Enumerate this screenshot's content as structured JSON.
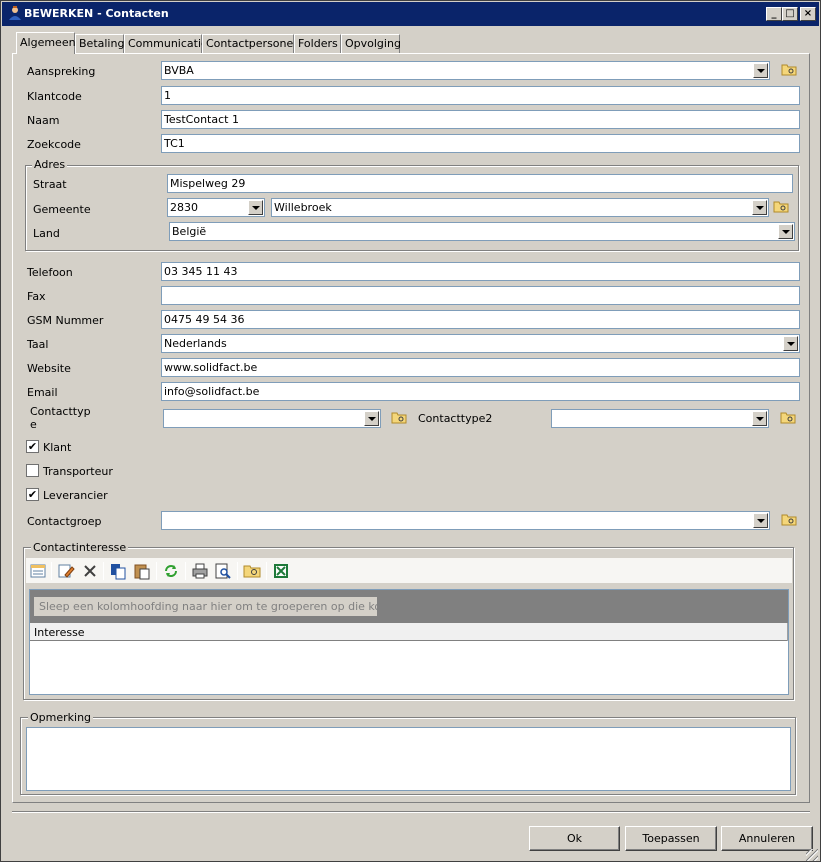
{
  "window": {
    "title": "BEWERKEN - Contacten"
  },
  "tabs": [
    "Algemeen",
    "Betaling",
    "Communicatie",
    "Contactpersonen",
    "Folders",
    "Opvolging"
  ],
  "fields": {
    "aanspreking_label": "Aanspreking",
    "aanspreking_value": "BVBA",
    "klantcode_label": "Klantcode",
    "klantcode_value": "1",
    "naam_label": "Naam",
    "naam_value": "TestContact 1",
    "zoekcode_label": "Zoekcode",
    "zoekcode_value": "TC1"
  },
  "adres": {
    "title": "Adres",
    "straat_label": "Straat",
    "straat_value": "Mispelweg 29",
    "gemeente_label": "Gemeente",
    "postcode_value": "2830",
    "gemeente_value": "Willebroek",
    "land_label": "Land",
    "land_value": "België"
  },
  "contact": {
    "telefoon_label": "Telefoon",
    "telefoon_value": "03 345 11 43",
    "fax_label": "Fax",
    "fax_value": "",
    "gsm_label": "GSM Nummer",
    "gsm_value": "0475 49 54 36",
    "taal_label": "Taal",
    "taal_value": "Nederlands",
    "website_label": "Website",
    "website_value": "www.solidfact.be",
    "email_label": "Email",
    "email_value": "info@solidfact.be",
    "contacttype_label_1": "Contacttyp",
    "contacttype_label_2": "e",
    "contacttype_value": "",
    "contacttype2_label": "Contacttype2",
    "contacttype2_value": ""
  },
  "checks": [
    {
      "label": "Klant",
      "checked": true
    },
    {
      "label": "Transporteur",
      "checked": false
    },
    {
      "label": "Leverancier",
      "checked": true
    }
  ],
  "check_mark": "✔",
  "contactgroep": {
    "label": "Contactgroep",
    "value": ""
  },
  "contactinteresse": {
    "title": "Contactinteresse",
    "toolbar_icons": [
      "properties-icon",
      "edit-icon",
      "delete-icon",
      "copy-icon",
      "paste-icon",
      "refresh-icon",
      "print-icon",
      "print-preview-icon",
      "folder-search-icon",
      "excel-icon"
    ],
    "group_hint": "Sleep een kolomhoofding naar hier om te groeperen op die kolom.",
    "columns": [
      "Interesse"
    ]
  },
  "opmerking": {
    "title": "Opmerking",
    "value": ""
  },
  "buttons": {
    "ok": "Ok",
    "apply": "Toepassen",
    "cancel": "Annuleren"
  },
  "colors": {
    "titlebar": "#0a246a",
    "background": "#d4d0c8",
    "grid_group": "#808080"
  }
}
